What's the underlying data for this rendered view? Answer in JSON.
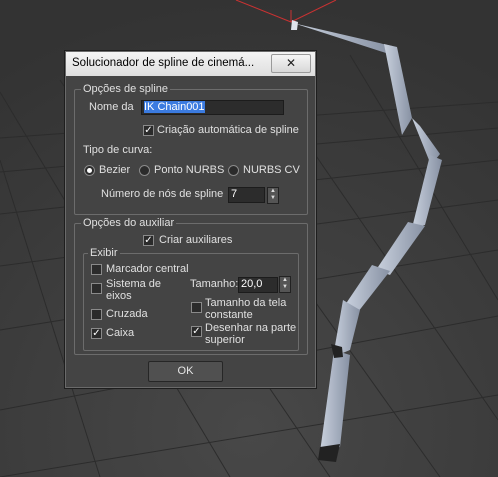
{
  "window": {
    "title": "Solucionador de spline de cinemá...",
    "close_glyph": "✕"
  },
  "spline_options": {
    "group_label": "Opções de spline",
    "name_label": "Nome da",
    "name_value": "IK Chain001",
    "auto_create_label": "Criação automática de spline",
    "auto_create_checked": true,
    "curve_type_label": "Tipo de curva:",
    "curve_types": [
      {
        "label": "Bezier",
        "selected": true
      },
      {
        "label": "Ponto NURBS",
        "selected": false
      },
      {
        "label": "NURBS CV",
        "selected": false
      }
    ],
    "nodes_label": "Número de nós de spline",
    "nodes_value": "7"
  },
  "helper_options": {
    "group_label": "Opções do auxiliar",
    "create_helpers_label": "Criar auxiliares",
    "create_helpers_checked": true,
    "display": {
      "group_label": "Exibir",
      "center_marker_label": "Marcador central",
      "center_marker_checked": false,
      "axis_tripod_label": "Sistema de eixos",
      "axis_tripod_checked": false,
      "cross_label": "Cruzada",
      "cross_checked": false,
      "box_label": "Caixa",
      "box_checked": true,
      "size_label": "Tamanho:",
      "size_value": "20,0",
      "constant_screen_label": "Tamanho da tela constante",
      "constant_screen_checked": false,
      "draw_on_top_label": "Desenhar na parte superior",
      "draw_on_top_checked": true
    }
  },
  "ok_label": "OK",
  "colors": {
    "viewport_bg": "#3a3a3a",
    "dialog_bg": "#444444",
    "titlebar": "#e8e8e8",
    "selection": "#3b7be0",
    "bone": "#a8b0c0"
  },
  "icons": [
    "close-icon",
    "check-icon",
    "spinner-up-icon",
    "spinner-down-icon"
  ]
}
